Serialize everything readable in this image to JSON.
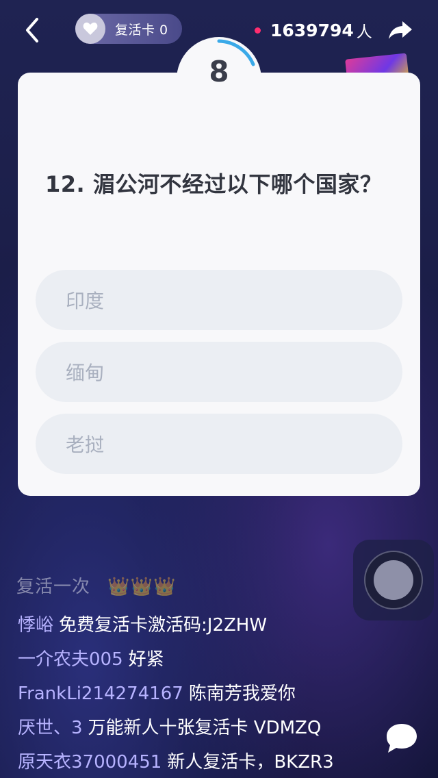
{
  "top_bar": {
    "revive_label": "复活卡 0",
    "viewer_count": "1639794",
    "viewer_unit": "人"
  },
  "timer": {
    "value": "8",
    "progress": 0.2
  },
  "question": {
    "text": "12. 湄公河不经过以下哪个国家？",
    "options": [
      "印度",
      "缅甸",
      "老挝"
    ]
  },
  "chat": {
    "faded_line": "复活一次",
    "crowns": "👑👑👑",
    "messages": [
      {
        "user": "悸峪",
        "text": "免费复活卡激活码:J2ZHW"
      },
      {
        "user": "一介农夫005",
        "text": "好紧"
      },
      {
        "user": "FrankLi214274167",
        "text": "陈南芳我爱你"
      },
      {
        "user": "厌世、3",
        "text": "万能新人十张复活卡   VDMZQ"
      },
      {
        "user": "原天衣37000451",
        "text": "新人复活卡，BKZR3"
      }
    ]
  },
  "icons": {
    "back": "chevron-left-icon",
    "heart": "heart-icon",
    "share": "share-arrow-icon",
    "chat": "chat-bubble-icon"
  },
  "colors": {
    "accent_ring": "#3aa9e8",
    "live_dot": "#ff2d6f",
    "username": "#b7b3ff",
    "card_bg": "#f8f8fa",
    "option_bg": "#ebeef3"
  }
}
